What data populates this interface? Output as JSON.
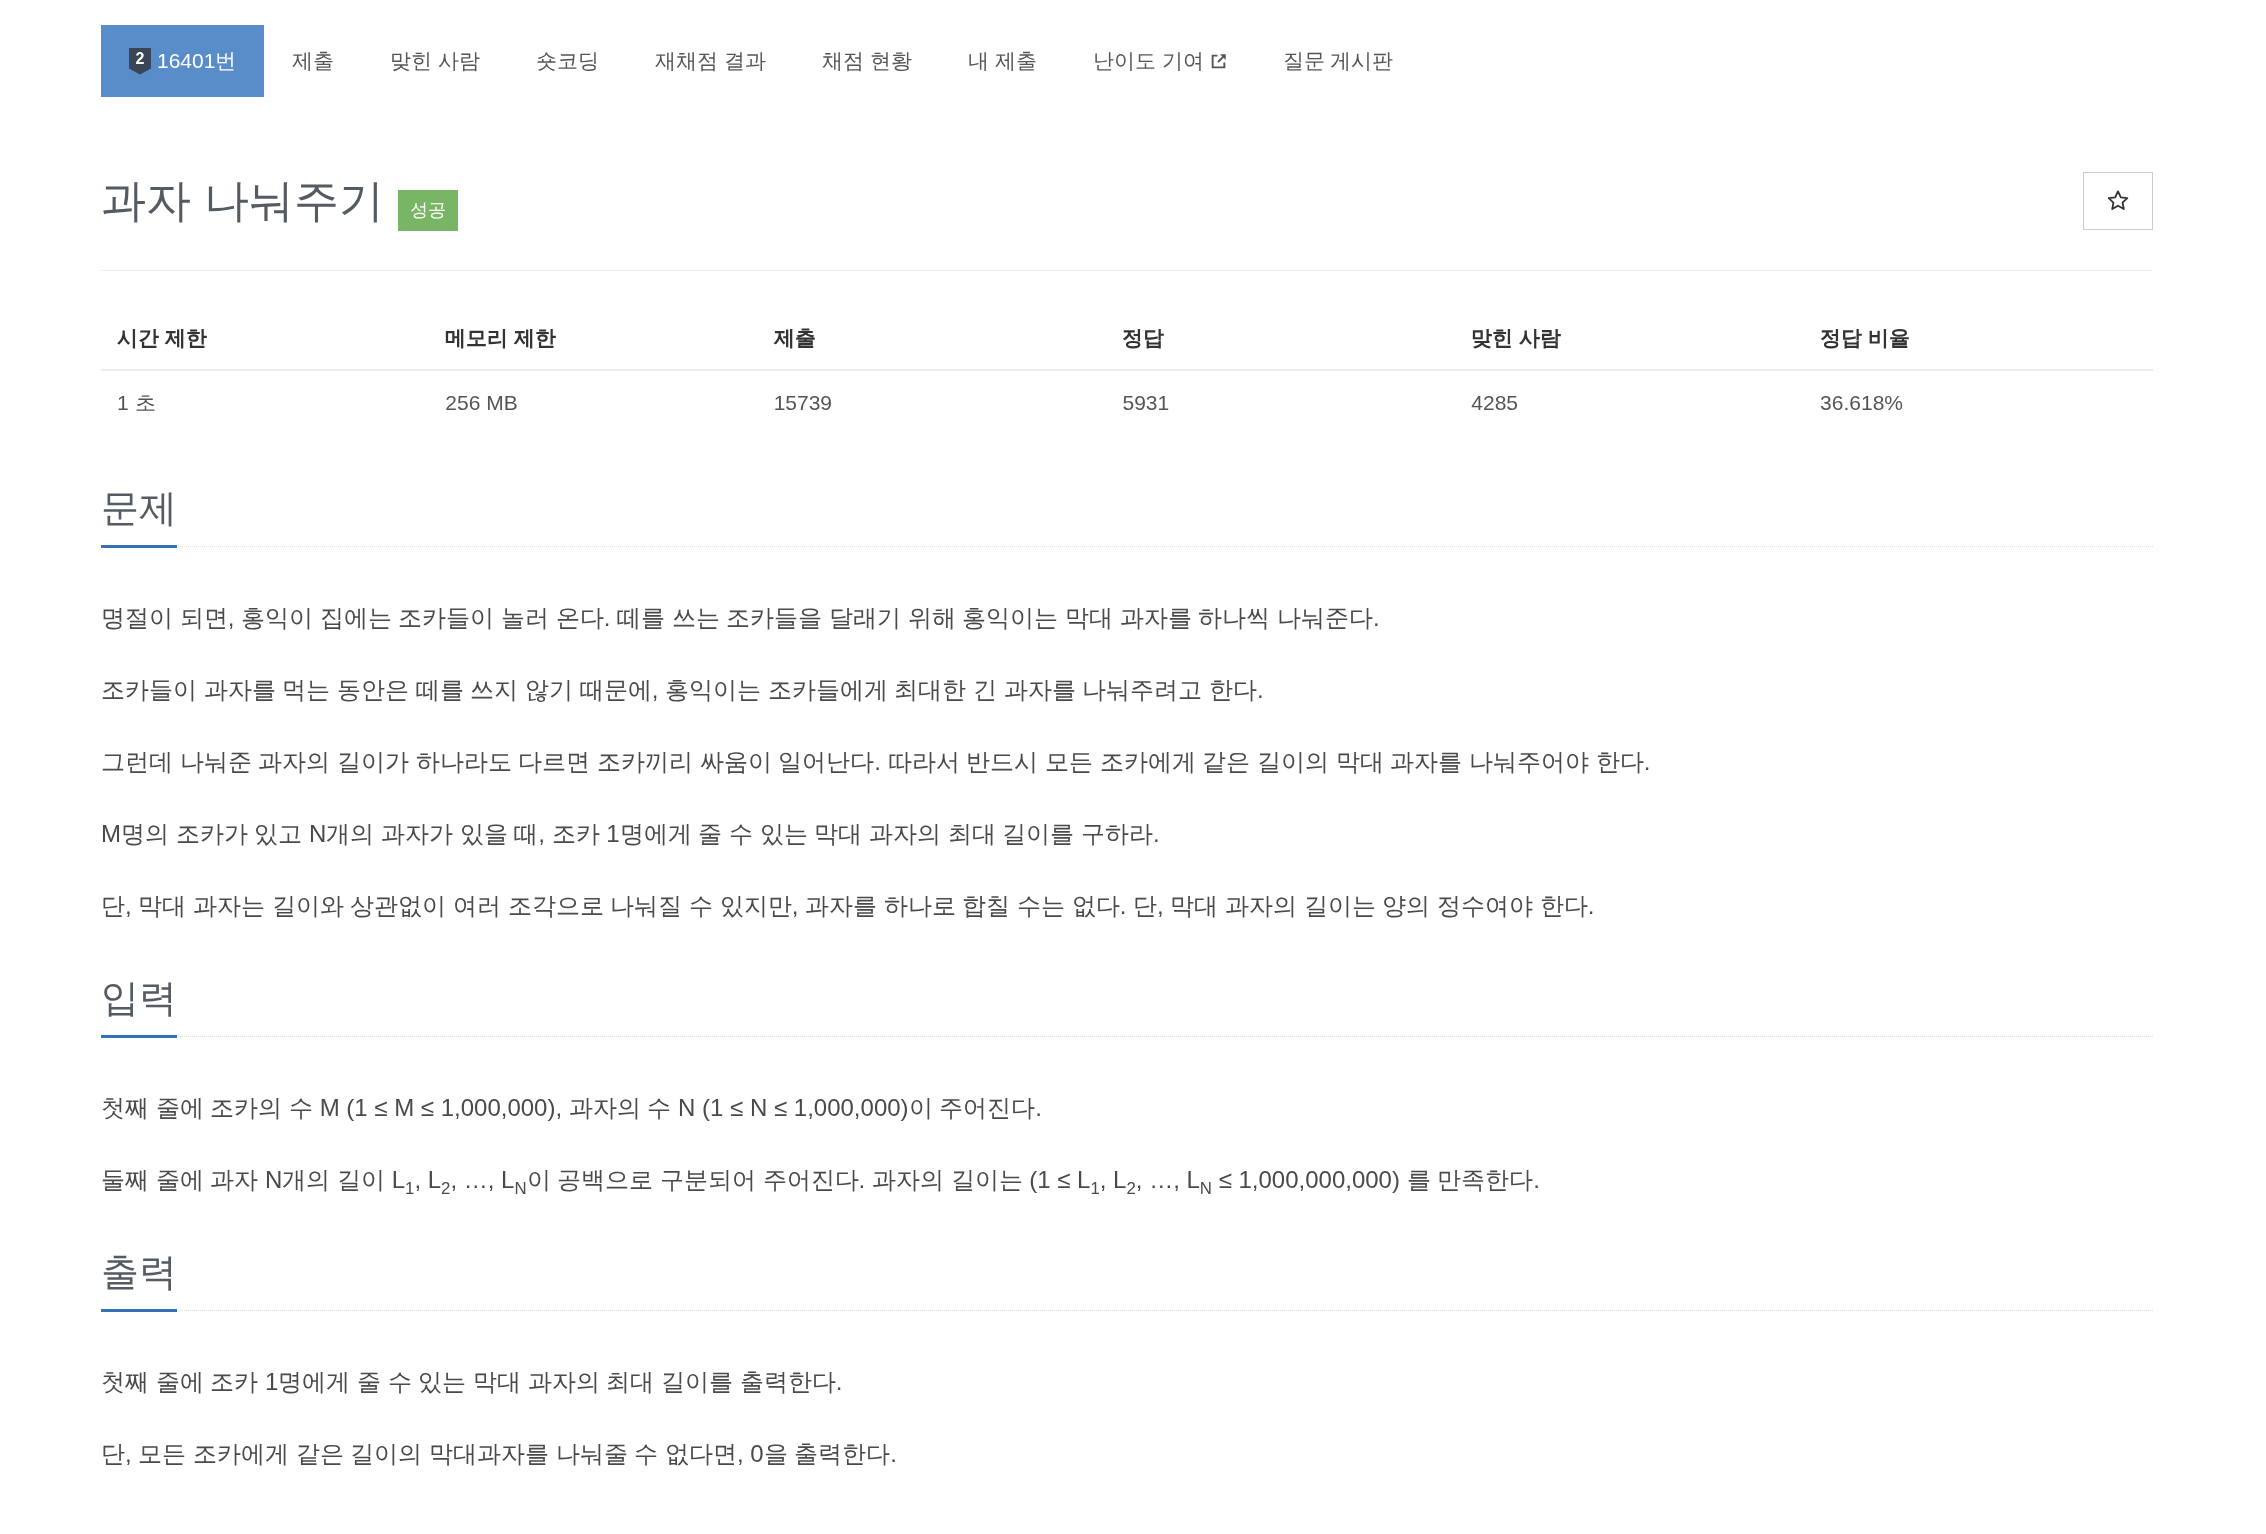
{
  "nav": {
    "tabs": [
      {
        "label": "16401번",
        "badge": "2",
        "selected": true,
        "external": false
      },
      {
        "label": "제출",
        "selected": false,
        "external": false
      },
      {
        "label": "맞힌 사람",
        "selected": false,
        "external": false
      },
      {
        "label": "숏코딩",
        "selected": false,
        "external": false
      },
      {
        "label": "재채점 결과",
        "selected": false,
        "external": false
      },
      {
        "label": "채점 현황",
        "selected": false,
        "external": false
      },
      {
        "label": "내 제출",
        "selected": false,
        "external": false
      },
      {
        "label": "난이도 기여",
        "selected": false,
        "external": true
      },
      {
        "label": "질문 게시판",
        "selected": false,
        "external": false
      }
    ]
  },
  "problem": {
    "title": "과자 나눠주기",
    "result": "성공",
    "starred": false
  },
  "stats": {
    "columns": [
      "시간 제한",
      "메모리 제한",
      "제출",
      "정답",
      "맞힌 사람",
      "정답 비율"
    ],
    "rows": [
      [
        "1 초",
        "256 MB",
        "15739",
        "5931",
        "4285",
        "36.618%"
      ]
    ]
  },
  "sections": [
    {
      "heading": "문제",
      "paragraphs": [
        "명절이 되면, 홍익이 집에는 조카들이 놀러 온다. 떼를 쓰는 조카들을 달래기 위해 홍익이는 막대 과자를 하나씩 나눠준다.",
        "조카들이 과자를 먹는 동안은 떼를 쓰지 않기 때문에, 홍익이는 조카들에게 최대한 긴 과자를 나눠주려고 한다.",
        "그런데 나눠준 과자의 길이가 하나라도 다르면 조카끼리 싸움이 일어난다. 따라서 반드시 모든 조카에게 같은 길이의 막대 과자를 나눠주어야 한다.",
        "M명의 조카가 있고 N개의 과자가 있을 때, 조카 1명에게 줄 수 있는 막대 과자의 최대 길이를 구하라.",
        "단, 막대 과자는 길이와 상관없이 여러 조각으로 나눠질 수 있지만, 과자를 하나로 합칠 수는 없다. 단, 막대 과자의 길이는 양의 정수여야 한다."
      ]
    },
    {
      "heading": "입력",
      "paragraphs": [
        "첫째 줄에 조카의 수 M (1 ≤ M ≤ 1,000,000), 과자의 수 N (1 ≤ N ≤ 1,000,000)이 주어진다.",
        "둘째 줄에 과자 N개의 길이 L$_{1}$, L$_{2}$, …, L$_{N}$이 공백으로 구분되어 주어진다. 과자의 길이는 (1 ≤ L$_{1}$, L$_{2}$, …, L$_{N}$ ≤ 1,000,000,000) 를 만족한다."
      ]
    },
    {
      "heading": "출력",
      "paragraphs": [
        "첫째 줄에 조카 1명에게 줄 수 있는 막대 과자의 최대 길이를 출력한다.",
        "단, 모든 조카에게 같은 길이의 막대과자를 나눠줄 수 없다면, 0을 출력한다."
      ]
    }
  ]
}
